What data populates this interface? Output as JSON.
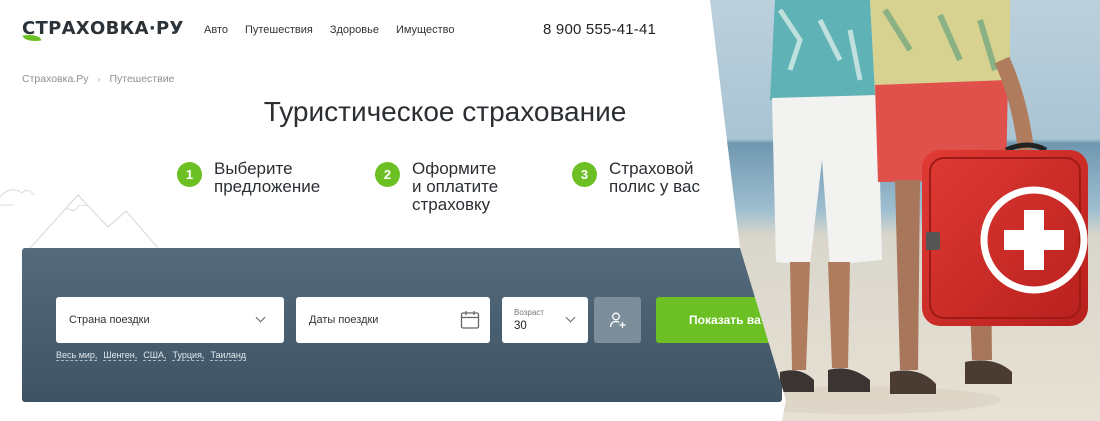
{
  "header": {
    "logo_text": "СТРАХОВКА·РУ",
    "nav": [
      "Авто",
      "Путешествия",
      "Здоровье",
      "Имущество"
    ],
    "phone": "8 900 555-41-41"
  },
  "breadcrumb": {
    "home": "Страховка.Ру",
    "separator": "›",
    "current": "Путешествие"
  },
  "title": "Туристическое страхование",
  "steps": [
    {
      "num": "1",
      "text": "Выберите\nпредложение"
    },
    {
      "num": "2",
      "text": "Оформите\nи оплатите\nстраховку"
    },
    {
      "num": "3",
      "text": "Страховой\nполис у вас"
    }
  ],
  "search": {
    "country_placeholder": "Страна поездки",
    "dates_placeholder": "Даты поездки",
    "age_label": "Возраст",
    "age_value": "30",
    "show_button": "Показать ва",
    "quick_countries": [
      "Весь мир,",
      "Шенген,",
      "США,",
      "Турция,",
      "Таиланд"
    ]
  },
  "colors": {
    "accent_green": "#6cc024",
    "panel_bg": "#4a5f6f",
    "add_button_bg": "#7c8e9a"
  },
  "icons": {
    "logo_leaf": "leaf-icon",
    "calendar": "calendar-icon",
    "add_traveler": "add-user-icon",
    "dropdown": "chevron-down-icon"
  }
}
